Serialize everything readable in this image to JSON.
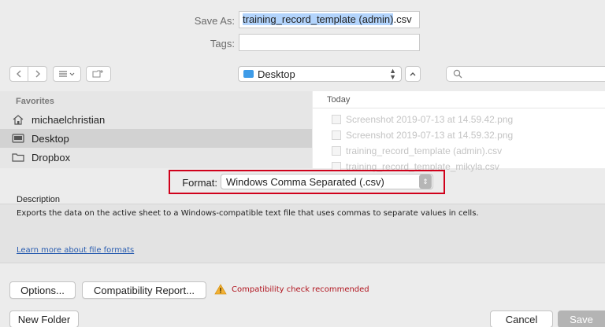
{
  "save_as": {
    "label": "Save As:",
    "name_selected": "training_record_template (admin)",
    "extension": ".csv"
  },
  "tags": {
    "label": "Tags:",
    "value": ""
  },
  "toolbar": {
    "location": "Desktop",
    "search_placeholder": ""
  },
  "sidebar": {
    "header": "Favorites",
    "items": [
      {
        "label": "michaelchristian",
        "icon": "home-icon"
      },
      {
        "label": "Desktop",
        "icon": "desktop-folder-icon",
        "selected": true
      },
      {
        "label": "Dropbox",
        "icon": "folder-icon"
      }
    ]
  },
  "filelist": {
    "column": "Today",
    "items": [
      {
        "name": "Screenshot 2019-07-13 at 14.59.42.png"
      },
      {
        "name": "Screenshot 2019-07-13 at 14.59.32.png"
      },
      {
        "name": "training_record_template (admin).csv"
      },
      {
        "name": "training_record_template_mikyla.csv"
      }
    ]
  },
  "format": {
    "label": "Format:",
    "value": "Windows Comma Separated (.csv)"
  },
  "description": {
    "title": "Description",
    "text": "Exports the data on the active sheet to a Windows-compatible text file that uses commas to separate values in cells.",
    "link": "Learn more about file formats"
  },
  "buttons": {
    "options": "Options...",
    "compat": "Compatibility Report...",
    "compat_warning": "Compatibility check recommended",
    "new_folder": "New Folder",
    "cancel": "Cancel",
    "save": "Save"
  },
  "colors": {
    "highlight": "#d0011b",
    "warning": "#b1141e",
    "link": "#2a5db0"
  }
}
